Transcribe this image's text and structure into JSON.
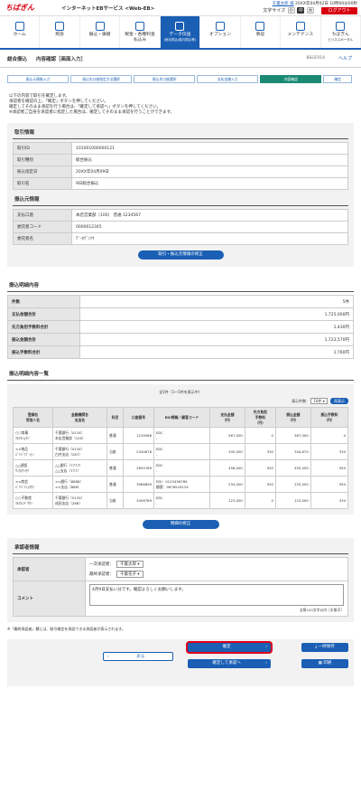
{
  "header": {
    "logo": "ちばぎん",
    "service": "インターネットEBサービス <Web-EB>",
    "user": "千葉太郎 様",
    "login_time": "20XX年04月02日 10時00分00秒",
    "font_size_label": "文字サイズ",
    "font_small": "小",
    "font_medium": "中",
    "font_large": "大",
    "logout": "ログアウト"
  },
  "nav": [
    {
      "label": "ホーム",
      "sub": ""
    },
    {
      "label": "照会",
      "sub": ""
    },
    {
      "label": "振込・振替",
      "sub": ""
    },
    {
      "label": "税金・各種料金",
      "sub": "払込み"
    },
    {
      "label": "データ伝送",
      "sub": "(総合振込/給与振込等)"
    },
    {
      "label": "オプション",
      "sub": ""
    },
    {
      "label": "承認",
      "sub": ""
    },
    {
      "label": "メンテナンス",
      "sub": ""
    },
    {
      "label": "ちばぎん",
      "sub": "ビジネスポータル"
    }
  ],
  "title": {
    "main": "総合振込",
    "sub": "内容確認［画面入力］",
    "screen_id": "BSGF014",
    "help": "ヘルプ"
  },
  "steps": [
    "振込元情報入力",
    "振込先口座指定方法選択",
    "振込先口座選択",
    "支払金額入力",
    "内容確認",
    "確定"
  ],
  "message": {
    "line1": "以下の内容で取引を確定します。",
    "line2": "承認者を確認の上、「確定」ボタンを押してください。",
    "line3": "確定してそのまま承認を行う場合は、「確定して承認へ」ボタンを押してください。",
    "line4": "※承認者ご自身を承認者に指定した場合は、確定してそのまま承認を行うことができます。"
  },
  "torihiki": {
    "heading": "取引情報",
    "rows": [
      {
        "k": "取引ID",
        "v": "101001000000121"
      },
      {
        "k": "取引種別",
        "v": "総合振込"
      },
      {
        "k": "振込指定日",
        "v": "20XX年04月09日"
      },
      {
        "k": "取引名",
        "v": "9日総合振込"
      }
    ]
  },
  "furikomimoto": {
    "heading": "振込元情報",
    "rows": [
      {
        "k": "支払口座",
        "v": "本店営業部（100） 普通 1234567"
      },
      {
        "k": "委託者コード",
        "v": "0000012345"
      },
      {
        "k": "委託者名",
        "v": "ﾃﾞｰﾀﾃﾞﾝｿｳ"
      }
    ],
    "fix_button": "取引・振込元情報の修正"
  },
  "meisai": {
    "heading": "振込明細内容",
    "rows": [
      {
        "k": "件数",
        "v": "5件"
      },
      {
        "k": "支払金額合計",
        "v": "1,725,000円"
      },
      {
        "k": "先方負担手数料合計",
        "v": "1,430円"
      },
      {
        "k": "振込金額合計",
        "v": "1,723,570円"
      },
      {
        "k": "振込手数料合計",
        "v": "1,760円"
      }
    ]
  },
  "list": {
    "heading": "振込明細内容一覧",
    "count": "全5件（1～5件を表示中）",
    "display_label": "表示件数：",
    "display_value": "10件",
    "redisplay": "再表示",
    "columns": [
      "登録名\n受取人名",
      "金融機関名\n支店名",
      "科目",
      "口座番号",
      "EDI情報／顧客コード",
      "支払金額\n（円）",
      "先方負担\n手数料\n（円）",
      "振込金額\n（円）",
      "振込手数料\n（円）"
    ],
    "rows": [
      {
        "name": "○○商事\nﾏﾙﾏﾙｼｮｳｼﾞ",
        "bank": "千葉銀行（0134）\n本店営業部（100）",
        "kamoku": "普通",
        "acct": "1234566",
        "edi": "EDI：\n-",
        "pay": "567,000",
        "fee_other": "0",
        "amt": "567,000",
        "fee": "0"
      },
      {
        "name": "××物品\nﾊﾞﾂﾊﾞﾂﾌﾞｯﾋﾝ",
        "bank": "千葉銀行（0134）\n白井支店（287）",
        "kamoku": "当座",
        "acct": "2345678",
        "edi": "EDI：\n-",
        "pay": "345,000",
        "fee_other": "330",
        "amt": "344,670",
        "fee": "330"
      },
      {
        "name": "△△建設\nｻﾝｶｸｹﾝｾﾂ",
        "bank": "△△銀行（7777）\n△△支店（777）",
        "kamoku": "普通",
        "acct": "2855769",
        "edi": "EDI：\n-",
        "pay": "456,000",
        "fee_other": "550",
        "amt": "455,450",
        "fee": "550"
      },
      {
        "name": "××商会\nﾊﾞﾂﾊﾞﾂｼｮｳｶｲ",
        "bank": "××銀行（8888）\n××支店（888）",
        "kamoku": "普通",
        "acct": "3966899",
        "edi": "EDI：0123456789\n顧客：9876543219",
        "pay": "234,000",
        "fee_other": "550",
        "amt": "233,450",
        "fee": "550"
      },
      {
        "name": "○○不動産\nﾏﾙﾏﾙﾌﾄﾞｳｻﾝ",
        "bank": "千葉銀行（0134）\n成田支店（286）",
        "kamoku": "当座",
        "acct": "3456789",
        "edi": "EDI：\n-",
        "pay": "123,000",
        "fee_other": "0",
        "amt": "123,000",
        "fee": "330"
      }
    ],
    "fix_button": "明細の修正"
  },
  "approver": {
    "heading": "承認者情報",
    "label": "承認者",
    "first_label": "一次承認者：",
    "first_value": "千葉太郎",
    "final_label": "最終承認者：",
    "final_value": "千葉花子",
    "comment_label": "コメント",
    "comment": "4月9日支払い分です。確認よろしくお願いします。",
    "comment_note": "全角120文字以内［半角可］"
  },
  "footnote": "※「最終承認者」欄には、取引確定を承認できる承認者が表示されます。",
  "actions": {
    "back": "戻る",
    "confirm": "確定",
    "confirm_approve": "確定して承認へ",
    "save": "一時保存",
    "print": "印刷"
  },
  "colors": {
    "brand_red": "#d7000f",
    "blue": "#1a5fb4",
    "step_active": "#1a8a74"
  }
}
